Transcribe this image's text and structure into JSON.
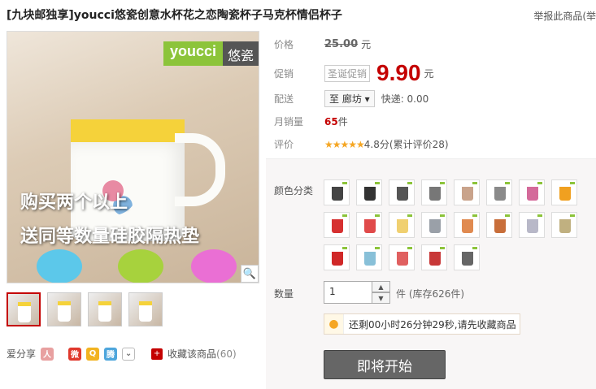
{
  "product": {
    "title": "[九块邮独享]youcci悠瓷创意水杯花之恋陶瓷杯子马克杯情侣杯子",
    "report_link": "举报此商品(举"
  },
  "main_image": {
    "logo_en": "youcci",
    "logo_cn": "悠瓷",
    "promo_line1": "购买两个以上",
    "promo_line2": "送同等数量硅胶隔热垫",
    "zoom_icon": "magnifier-icon"
  },
  "thumbnails": [
    {
      "id": "thumb-1",
      "active": true
    },
    {
      "id": "thumb-2",
      "active": false
    },
    {
      "id": "thumb-3",
      "active": false
    },
    {
      "id": "thumb-4",
      "active": false
    }
  ],
  "share": {
    "label": "爱分享",
    "favorite_label": "收藏该商品",
    "favorite_count": "(60)"
  },
  "info": {
    "price_label": "价格",
    "original_price": "25.00",
    "currency": "元",
    "promo_label": "促销",
    "promo_tag": "圣诞促销",
    "promo_price": "9.90",
    "shipping_label": "配送",
    "shipping_dest": "至 廊坊",
    "shipping_fee": "快递: 0.00",
    "monthly_sales_label": "月销量",
    "monthly_sales_value": "65",
    "monthly_sales_unit": "件",
    "rating_label": "评价",
    "rating_stars": "★★★★★",
    "rating_text": "4.8分(累计评价28)"
  },
  "sku": {
    "color_label": "颜色分类",
    "swatch_colors": [
      "#444444",
      "#333333",
      "#555555",
      "#777777",
      "#c9a38b",
      "#8a8a8a",
      "#d46a9a",
      "#f0a020",
      "#d63030",
      "#e04a4a",
      "#f0d070",
      "#9aa0a8",
      "#e08a50",
      "#c86e3a",
      "#b8b8c8",
      "#c0b080",
      "#d02828",
      "#88c0d8",
      "#e06060",
      "#c83838",
      "#666666"
    ],
    "qty_label": "数量",
    "qty_value": "1",
    "qty_unit": "件 (库存626件)",
    "countdown": "还剩00小时26分钟29秒,请先收藏商品",
    "buy_button": "即将开始"
  }
}
